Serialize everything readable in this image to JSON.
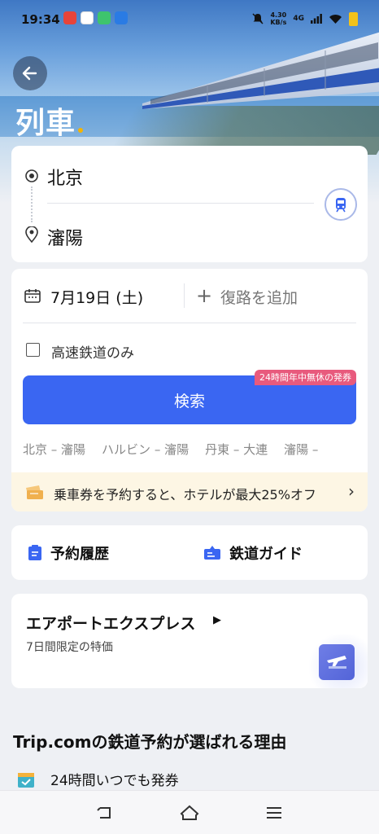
{
  "status_bar": {
    "time": "19:34",
    "net_speed_value": "4.30",
    "net_speed_unit": "KB/s",
    "network": "4G"
  },
  "header": {
    "title": "列車"
  },
  "route": {
    "from": "北京",
    "to": "瀋陽"
  },
  "booking": {
    "date": "7月19日 (土)",
    "return_label": "復路を追加",
    "highspeed_label": "高速鉄道のみ",
    "search_label": "検索",
    "promo_badge": "24時間年中無休の発券",
    "recent_routes": [
      "北京 – 瀋陽",
      "ハルビン – 瀋陽",
      "丹東 – 大連",
      "瀋陽 –"
    ],
    "hotel_promo": "乗車券を予約すると、ホテルが最大25%オフ"
  },
  "links": {
    "history": "予約履歴",
    "guide": "鉄道ガイド"
  },
  "express": {
    "title": "エアポートエクスプレス",
    "subtitle": "7日間限定の特価"
  },
  "why": {
    "title": "Trip.comの鉄道予約が選ばれる理由",
    "item1": "24時間いつでも発券"
  },
  "colors": {
    "accent": "#3a66f2",
    "badge": "#e85a7d",
    "promo_bg": "#fdf6e4"
  }
}
